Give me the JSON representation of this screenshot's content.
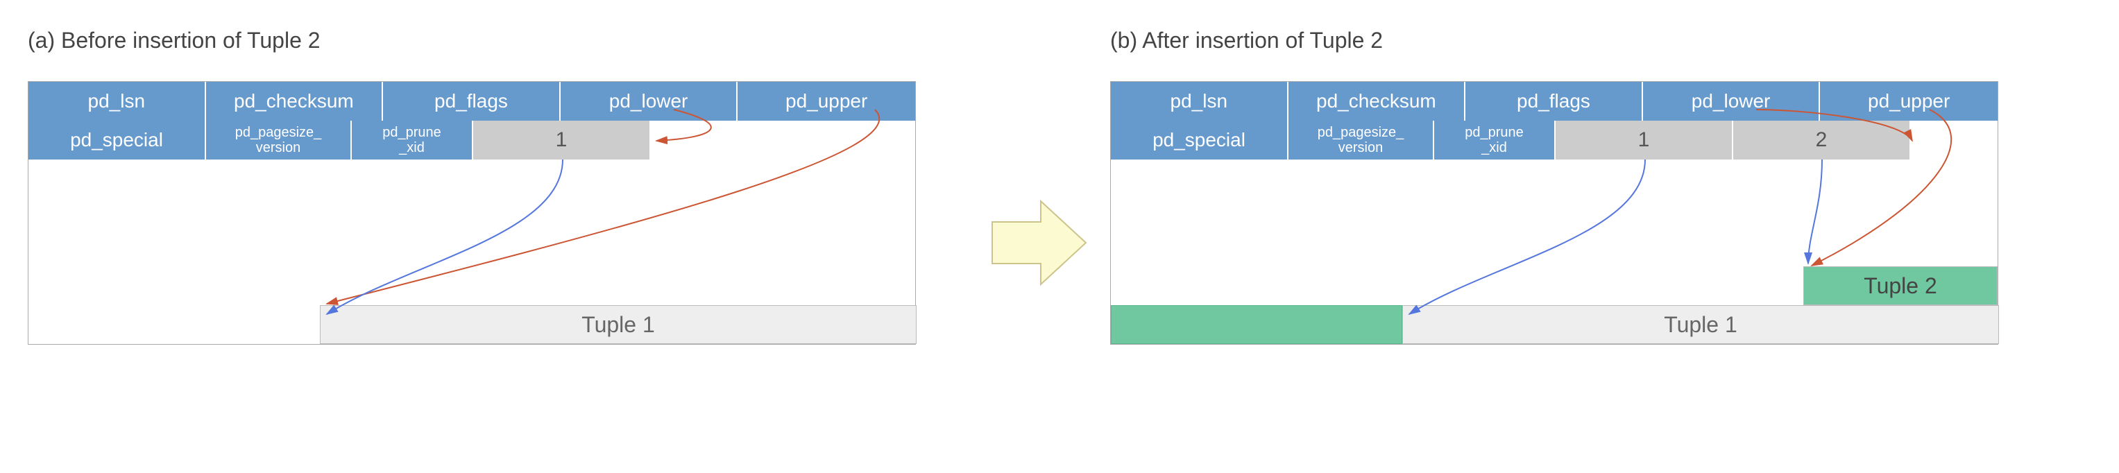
{
  "panel_a": {
    "title": "(a) Before insertion of Tuple 2",
    "header_row1": [
      "pd_lsn",
      "pd_checksum",
      "pd_flags",
      "pd_lower",
      "pd_upper"
    ],
    "header_row2": [
      "pd_special",
      "pd_pagesize_\nversion",
      "pd_prune\n_xid"
    ],
    "line_pointers": [
      "1"
    ],
    "tuples": [
      {
        "label": "Tuple 1",
        "class": ""
      }
    ]
  },
  "panel_b": {
    "title": "(b) After insertion of Tuple 2",
    "header_row1": [
      "pd_lsn",
      "pd_checksum",
      "pd_flags",
      "pd_lower",
      "pd_upper"
    ],
    "header_row2": [
      "pd_special",
      "pd_pagesize_\nversion",
      "pd_prune\n_xid"
    ],
    "line_pointers": [
      "1",
      "2"
    ],
    "tuples": [
      {
        "label": "Tuple 1",
        "class": ""
      },
      {
        "label": "Tuple 2",
        "class": "green"
      }
    ]
  }
}
